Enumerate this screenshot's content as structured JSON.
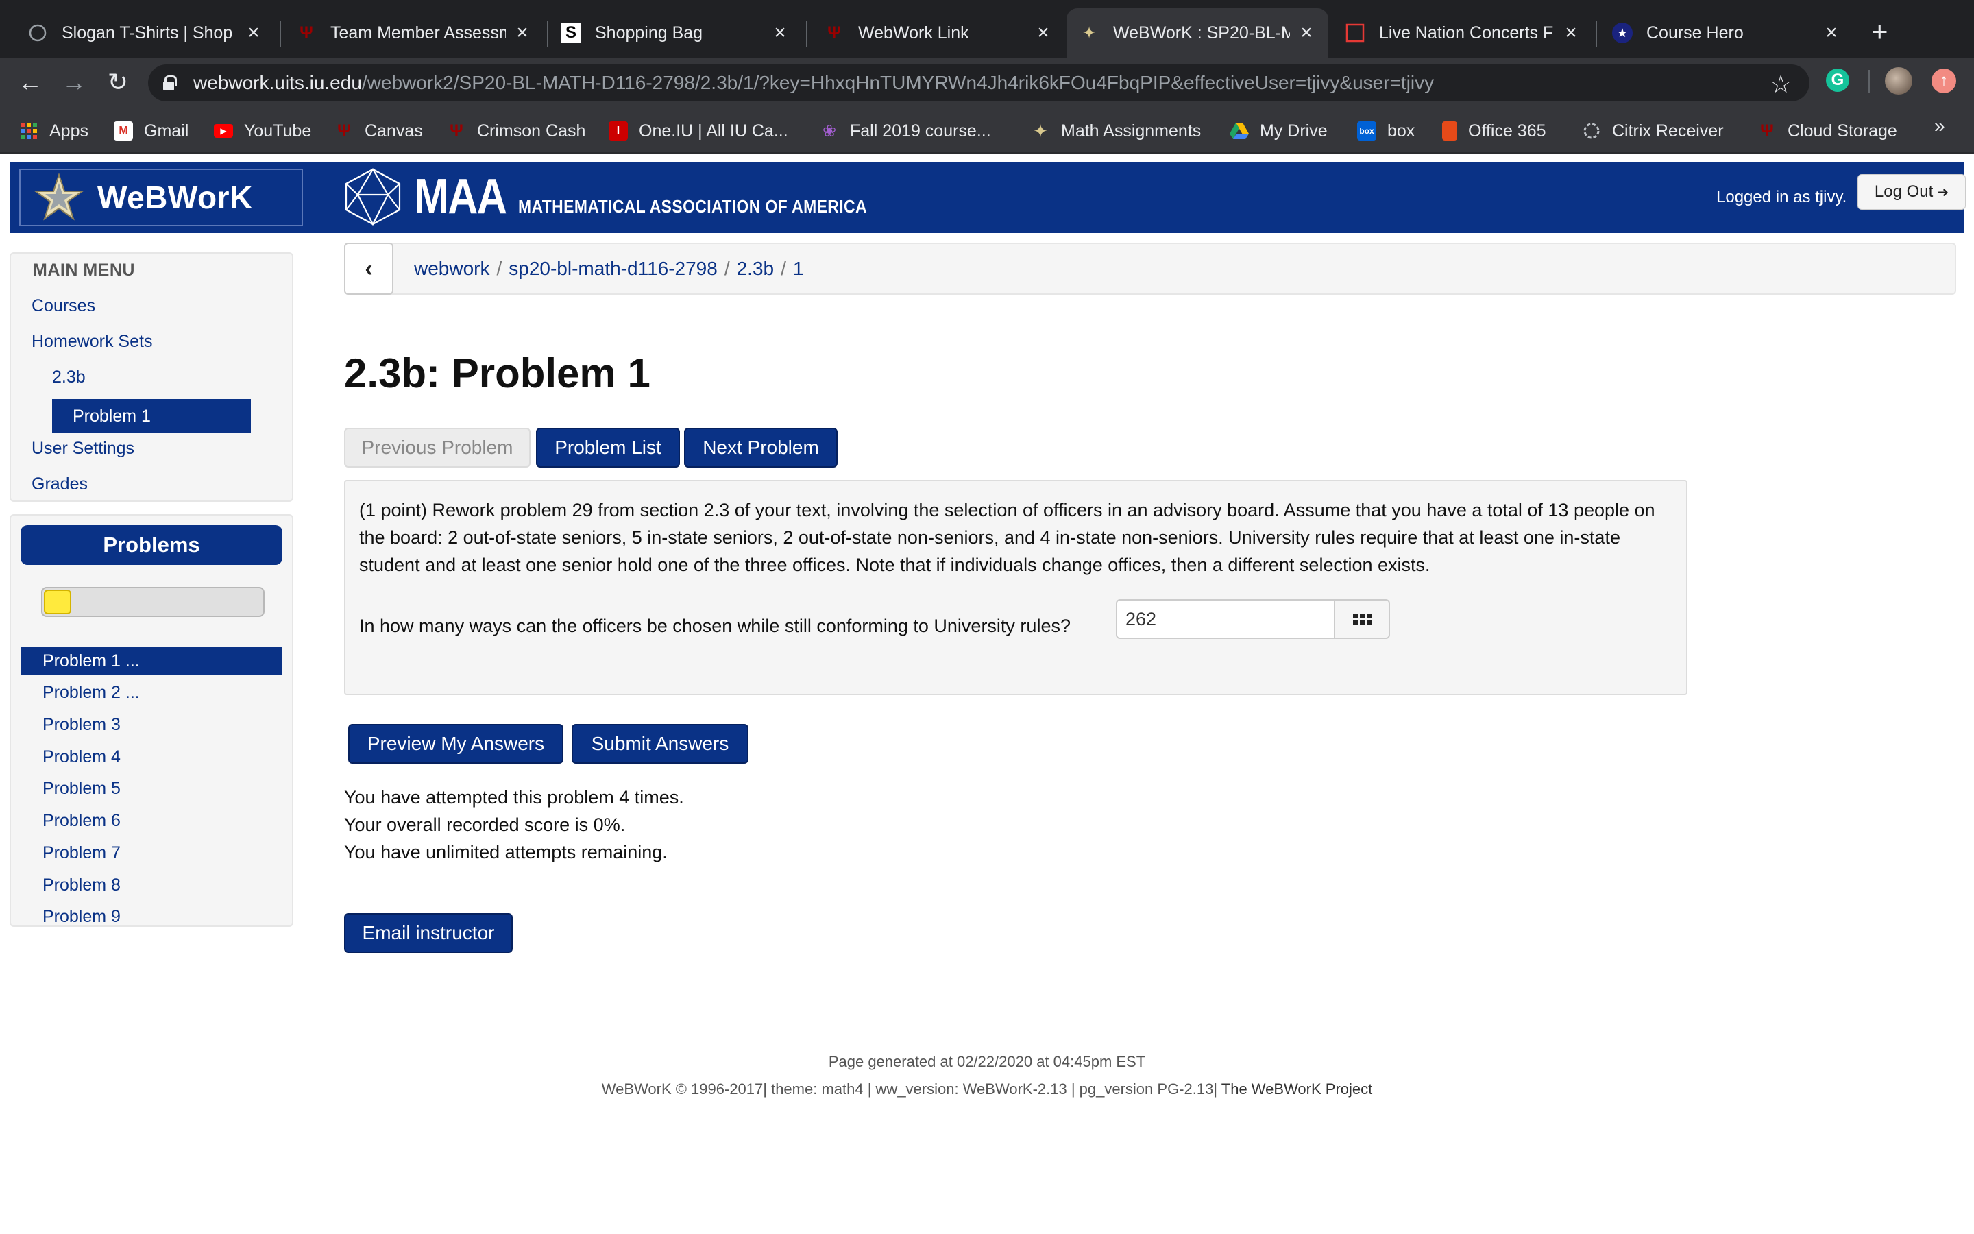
{
  "browser": {
    "tabs": [
      {
        "title": "Slogan T-Shirts | Shop",
        "icon": "circle-icon"
      },
      {
        "title": "Team Member Assessm",
        "icon": "iu-trident-icon"
      },
      {
        "title": "Shopping Bag",
        "icon": "s-logo-icon"
      },
      {
        "title": "WebWork Link",
        "icon": "iu-trident-icon"
      },
      {
        "title": "WeBWorK : SP20-BL-M",
        "icon": "webwork-star-icon"
      },
      {
        "title": "Live Nation Concerts F",
        "icon": "live-nation-icon"
      },
      {
        "title": "Course Hero",
        "icon": "course-hero-icon"
      }
    ],
    "url_host": "webwork.uits.iu.edu",
    "url_path": "/webwork2/SP20-BL-MATH-D116-2798/2.3b/1/?key=HhxqHnTUMYRWn4Jh4rik6kFOu4FbqPIP&effectiveUser=tjivy&user=tjivy",
    "bookmarks": [
      {
        "label": "Apps",
        "icon": "apps-grid-icon",
        "color": "#ea4335"
      },
      {
        "label": "Gmail",
        "icon": "gmail-icon",
        "color": "#d93025"
      },
      {
        "label": "YouTube",
        "icon": "youtube-icon",
        "color": "#ff0000"
      },
      {
        "label": "Canvas",
        "icon": "iu-trident-icon",
        "color": "#990000"
      },
      {
        "label": "Crimson Cash",
        "icon": "iu-trident-icon",
        "color": "#990000"
      },
      {
        "label": "One.IU | All IU Ca...",
        "icon": "one-iu-icon",
        "color": "#cc0000"
      },
      {
        "label": "Fall 2019 course...",
        "icon": "grape-icon",
        "color": "#8e44ad"
      },
      {
        "label": "Math Assignments",
        "icon": "webwork-star-icon",
        "color": "#c8b98a"
      },
      {
        "label": "My Drive",
        "icon": "google-drive-icon",
        "color": "#1fa463"
      },
      {
        "label": "box",
        "icon": "box-icon",
        "color": "#0061d5"
      },
      {
        "label": "Office 365",
        "icon": "office-icon",
        "color": "#e64a19"
      },
      {
        "label": "Citrix Receiver",
        "icon": "citrix-icon",
        "color": "#9aa0a6"
      },
      {
        "label": "Cloud Storage",
        "icon": "iu-trident-icon",
        "color": "#990000"
      }
    ]
  },
  "header": {
    "logo_text": "WeBWorK",
    "maa_big": "MAA",
    "maa_small": "MATHEMATICAL ASSOCIATION OF AMERICA",
    "logged_in": "Logged in as tjivy.",
    "logout_label": "Log Out"
  },
  "sidebar": {
    "menu_title": "MAIN MENU",
    "items": [
      {
        "label": "Courses"
      },
      {
        "label": "Homework Sets"
      },
      {
        "label": "2.3b"
      },
      {
        "label": "Problem 1"
      },
      {
        "label": "User Settings"
      },
      {
        "label": "Grades"
      }
    ],
    "problems_title": "Problems",
    "progress": 0.1,
    "problems": [
      {
        "label": "Problem 1 ..."
      },
      {
        "label": "Problem 2 ..."
      },
      {
        "label": "Problem 3"
      },
      {
        "label": "Problem 4"
      },
      {
        "label": "Problem 5"
      },
      {
        "label": "Problem 6"
      },
      {
        "label": "Problem 7"
      },
      {
        "label": "Problem 8"
      },
      {
        "label": "Problem 9"
      }
    ]
  },
  "breadcrumb": [
    "webwork",
    "sp20-bl-math-d116-2798",
    "2.3b",
    "1"
  ],
  "main": {
    "title": "2.3b: Problem 1",
    "prev_label": "Previous Problem",
    "list_label": "Problem List",
    "next_label": "Next Problem",
    "problem_text": "(1 point) Rework problem 29 from section 2.3 of your text, involving the selection of officers in an advisory board. Assume that you have a total of 13 people on the board: 2 out-of-state seniors, 5 in-state seniors, 2 out-of-state non-seniors, and 4 in-state non-seniors. University rules require that at least one in-state student and at least one senior hold one of the three offices. Note that if individuals change offices, then a different selection exists.",
    "question": "In how many ways can the officers be chosen while still conforming to University rules?",
    "answer_value": "262",
    "preview_label": "Preview My Answers",
    "submit_label": "Submit Answers",
    "status": [
      "You have attempted this problem 4 times.",
      "Your overall recorded score is 0%.",
      "You have unlimited attempts remaining."
    ],
    "email_label": "Email instructor"
  },
  "footer": {
    "generated": "Page generated at 02/22/2020 at 04:45pm EST",
    "version_prefix": "WeBWorK © 1996-2017| theme: math4 | ww_version: WeBWorK-2.13 | pg_version PG-2.13|",
    "project_link": "The WeBWorK Project"
  },
  "colors": {
    "brand_blue": "#0a3286",
    "progress_yellow": "#ffea3d"
  }
}
